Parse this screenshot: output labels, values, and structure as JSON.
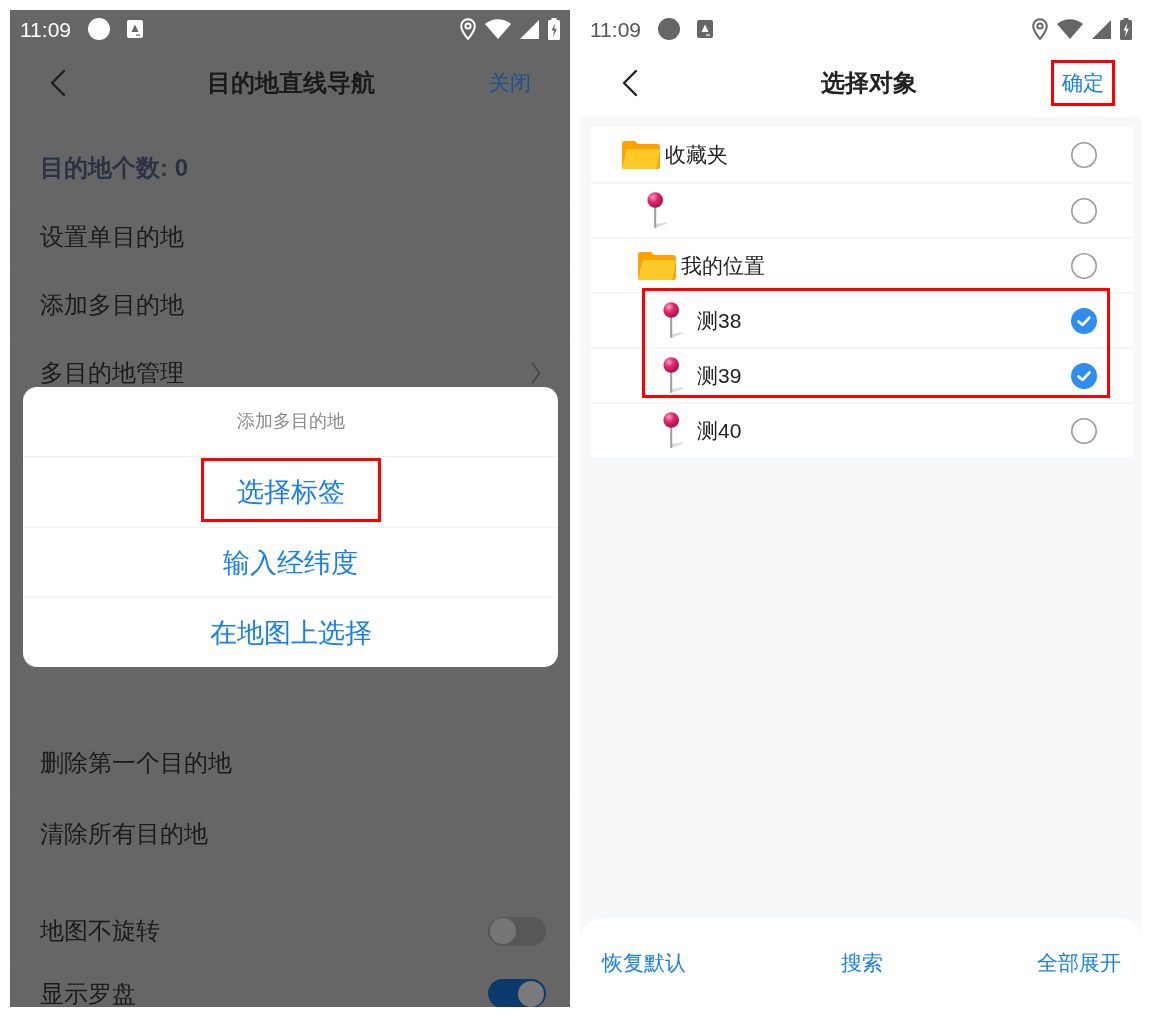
{
  "settings_screen": {
    "status_bar": {
      "time": "11:09"
    },
    "header": {
      "title": "目的地直线导航",
      "action": "关闭"
    },
    "sections": [
      {
        "items": [
          {
            "kind": "count",
            "label": "目的地个数: 0"
          },
          {
            "kind": "action",
            "label": "设置单目的地"
          },
          {
            "kind": "action",
            "label": "添加多目的地"
          },
          {
            "kind": "submenu",
            "label": "多目的地管理"
          }
        ]
      },
      {
        "items": [
          {
            "kind": "action",
            "label": "删除第一个目的地"
          },
          {
            "kind": "action",
            "label": "清除所有目的地"
          }
        ]
      },
      {
        "items": [
          {
            "kind": "toggle",
            "label": "地图不旋转",
            "on": false
          },
          {
            "kind": "toggle",
            "label": "显示罗盘",
            "on": true
          }
        ]
      }
    ],
    "dialog": {
      "title": "添加多目的地",
      "options": [
        {
          "label": "选择标签",
          "highlighted": true
        },
        {
          "label": "输入经纬度",
          "highlighted": false
        },
        {
          "label": "在地图上选择",
          "highlighted": false
        }
      ]
    }
  },
  "object_picker": {
    "status_bar": {
      "time": "11:09"
    },
    "header": {
      "title": "选择对象",
      "confirm": {
        "label": "确定",
        "highlighted": true
      }
    },
    "tree": [
      {
        "kind": "folder",
        "name": "收藏夹",
        "selected": false,
        "highlighted": false,
        "children": [
          {
            "kind": "pin",
            "selected": false,
            "highlighted": false
          },
          {
            "kind": "folder",
            "name": "我的位置",
            "selected": false,
            "highlighted": false,
            "children": [
              {
                "kind": "pin",
                "name": "测38",
                "selected": true,
                "highlighted": true
              },
              {
                "kind": "pin",
                "name": "测39",
                "selected": true,
                "highlighted": true
              },
              {
                "kind": "pin",
                "name": "测40",
                "selected": false,
                "highlighted": false
              }
            ]
          }
        ]
      }
    ],
    "bottom_bar": [
      "恢复默认",
      "搜索",
      "全部展开"
    ]
  }
}
